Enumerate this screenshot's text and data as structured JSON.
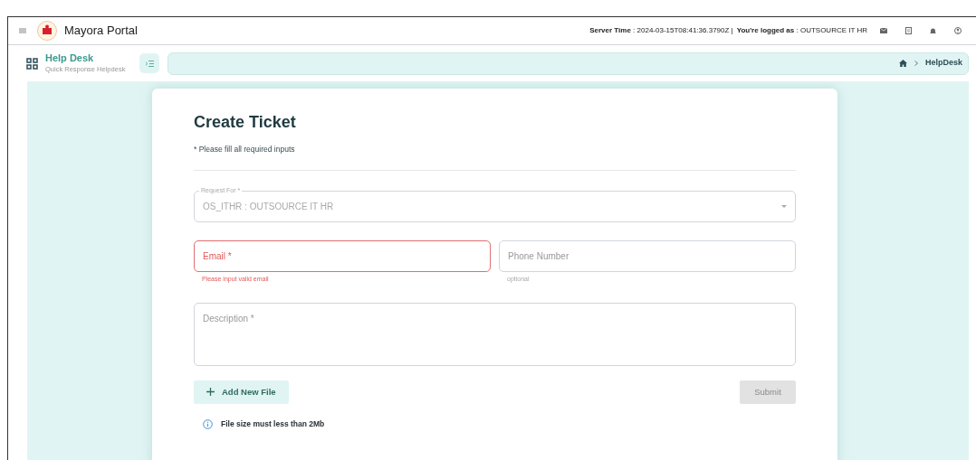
{
  "topbar": {
    "title": "Mayora Portal",
    "server_time": "**Server Time** : 2024-03-15T08:41:36.3790Z |",
    "logged_as": "**You're logged as** : OUTSOURCE IT HR"
  },
  "module": {
    "title": "Help Desk",
    "subtitle": "Quick Response Helpdesk"
  },
  "breadcrumb": [
    "HelpDesk"
  ],
  "form": {
    "title": "Create Ticket",
    "note": "* Please fill all required inputs",
    "fields": [
      {
        "kind": "select",
        "label": "Request For *",
        "value": "OS_ITHR : OUTSOURCE IT HR",
        "disabled": true
      },
      {
        "kind": "text",
        "placeholder": "Email *",
        "error": "Please input valid email"
      },
      {
        "kind": "text",
        "placeholder": "Phone Number",
        "hint": "optional"
      },
      {
        "kind": "textarea",
        "placeholder": "Description *"
      }
    ],
    "add_file": "Add New File",
    "submit": {
      "label": "Submit",
      "disabled": true
    },
    "info": "File size must less than 2Mb"
  }
}
